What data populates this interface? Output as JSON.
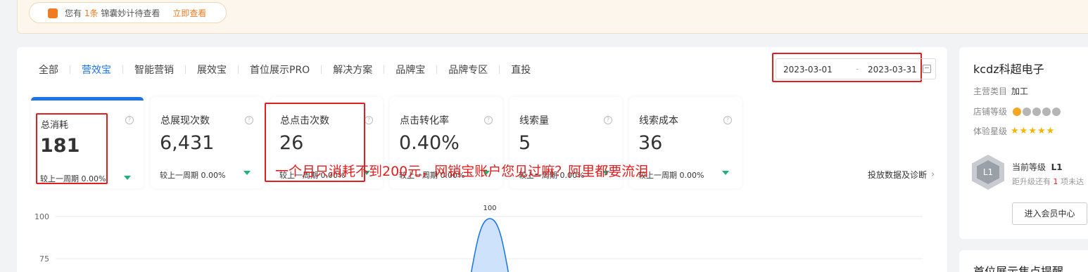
{
  "banner": {
    "text_prefix": "您有",
    "count": "1条",
    "text_suffix": "锦囊妙计待查看",
    "link": "立即查看"
  },
  "tabs": [
    {
      "label": "全部",
      "active": false
    },
    {
      "label": "营效宝",
      "active": true
    },
    {
      "label": "智能营销",
      "active": false
    },
    {
      "label": "展效宝",
      "active": false
    },
    {
      "label": "首位展示PRO",
      "active": false
    },
    {
      "label": "解决方案",
      "active": false
    },
    {
      "label": "品牌宝",
      "active": false
    },
    {
      "label": "品牌专区",
      "active": false
    },
    {
      "label": "直投",
      "active": false
    }
  ],
  "date_range": {
    "start": "2023-03-01",
    "separator": "-",
    "end": "2023-03-31"
  },
  "metrics": [
    {
      "label": "总消耗",
      "value": "181",
      "compare": "较上一周期 0.00%",
      "active": true
    },
    {
      "label": "总展现次数",
      "value": "6,431",
      "compare": "较上一周期 0.00%",
      "active": false
    },
    {
      "label": "总点击次数",
      "value": "26",
      "compare": "较上一周期 0.00%",
      "active": false
    },
    {
      "label": "点击转化率",
      "value": "0.40%",
      "compare": "较上一周期 0.00%",
      "active": false
    },
    {
      "label": "线索量",
      "value": "5",
      "compare": "较上一周期 0.00%",
      "active": false
    },
    {
      "label": "线索成本",
      "value": "36",
      "compare": "较上一周期 0.00%",
      "active": false
    }
  ],
  "diagnose_link": "投放数据及诊断",
  "annotation": "一个月只消耗不到200元，网销宝账户您见过嘛？阿里都要流泪",
  "chart_data": {
    "type": "area",
    "y_ticks": [
      "100",
      "75"
    ],
    "peak_label": "100",
    "series": [
      {
        "values": [
          0,
          0,
          100,
          0,
          0
        ]
      }
    ],
    "ylim": [
      0,
      100
    ],
    "color": "#1b73e8"
  },
  "side": {
    "shop_name": "kcdz科超电子",
    "main_category_label": "主营类目",
    "main_category_value": "加工",
    "store_level_label": "店铺等级",
    "experience_label": "体验星级",
    "stars": 5,
    "badge_text": "L1",
    "current_level_label": "当前等级",
    "current_level_value": "L1",
    "upgrade_prefix": "距升级还有",
    "upgrade_count": "1",
    "upgrade_suffix": "项未达",
    "member_button": "进入会员中心"
  },
  "side2": {
    "title": "首位展示焦点提醒"
  }
}
